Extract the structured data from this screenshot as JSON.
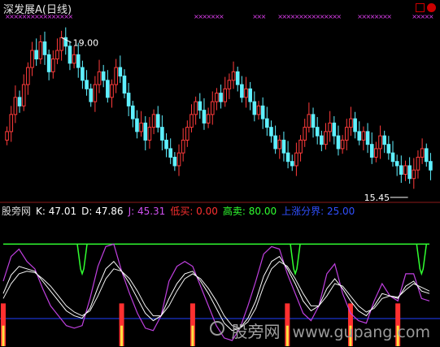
{
  "header": {
    "stock_title": "深发展A",
    "period": "(日线)"
  },
  "indicator_row": [
    {
      "label": "股旁网",
      "color": "#dcdcdc"
    },
    {
      "label": "K: 47.01",
      "color": "#ffffff"
    },
    {
      "label": "D: 47.86",
      "color": "#ffffff"
    },
    {
      "label": "J: 45.31",
      "color": "#d050f0"
    },
    {
      "label": "低买: 0.00",
      "color": "#ff3030"
    },
    {
      "label": "高卖: 80.00",
      "color": "#30ff30"
    },
    {
      "label": "上涨分界: 25.00",
      "color": "#3050ff"
    }
  ],
  "watermark": {
    "cn": "股旁网",
    "url": "www.gupang.com"
  },
  "colors": {
    "up_candle": "#ff3b3b",
    "down_candle": "#5ff0ff",
    "marker": "#e040f0",
    "k_line": "#ffffff",
    "d_line": "#f0f0f0",
    "j_line": "#c040e0",
    "sell_line": "#30ff30",
    "buy_bar": "#ff3030",
    "buy_bar_core": "#ffe040",
    "boundary": "#2040ff"
  },
  "chart_data": [
    {
      "type": "candlestick",
      "title": "深发展A (日线)",
      "annotations": [
        {
          "text": "19.00",
          "x_index": 13,
          "price": 19.0
        },
        {
          "text": "15.45",
          "x_index": 96,
          "price": 15.45
        }
      ],
      "ylim": [
        15.2,
        19.5
      ],
      "close_values": [
        16.8,
        17.2,
        17.6,
        17.4,
        17.9,
        18.3,
        18.7,
        18.5,
        18.9,
        18.6,
        18.2,
        18.5,
        18.7,
        19.0,
        18.8,
        18.4,
        18.6,
        18.3,
        18.0,
        17.8,
        17.5,
        17.9,
        18.2,
        18.0,
        17.6,
        17.9,
        18.3,
        18.1,
        17.7,
        17.4,
        17.1,
        16.8,
        17.0,
        16.6,
        16.9,
        17.2,
        16.9,
        16.6,
        16.4,
        16.2,
        16.0,
        16.3,
        16.6,
        16.9,
        17.2,
        17.5,
        17.3,
        17.0,
        17.2,
        17.5,
        17.7,
        17.5,
        17.8,
        18.0,
        18.2,
        17.9,
        17.6,
        17.8,
        17.5,
        17.2,
        17.4,
        17.1,
        16.9,
        16.7,
        16.4,
        16.6,
        16.3,
        16.1,
        16.0,
        16.3,
        16.6,
        16.9,
        17.2,
        16.9,
        16.7,
        16.5,
        16.8,
        17.0,
        16.7,
        16.4,
        16.6,
        16.9,
        17.1,
        16.8,
        16.6,
        16.8,
        16.5,
        16.2,
        16.4,
        16.7,
        16.5,
        16.3,
        16.1,
        16.0,
        15.8,
        16.0,
        15.7,
        15.9,
        16.2,
        16.4,
        16.1,
        15.9
      ]
    },
    {
      "type": "line",
      "title": "股旁网",
      "ylim": [
        0,
        100
      ],
      "series": [
        {
          "name": "K",
          "values": [
            40,
            55,
            62,
            60,
            58,
            50,
            42,
            34,
            26,
            22,
            20,
            28,
            45,
            60,
            66,
            58,
            48,
            36,
            24,
            18,
            22,
            36,
            48,
            56,
            58,
            50,
            40,
            28,
            16,
            10,
            12,
            20,
            34,
            54,
            66,
            70,
            60,
            48,
            34,
            26,
            30,
            44,
            52,
            44,
            34,
            26,
            22,
            30,
            40,
            38,
            36,
            46,
            50,
            42,
            40
          ]
        },
        {
          "name": "D",
          "values": [
            36,
            48,
            56,
            58,
            57,
            52,
            46,
            38,
            30,
            25,
            22,
            26,
            38,
            52,
            60,
            58,
            52,
            42,
            30,
            22,
            22,
            30,
            42,
            52,
            56,
            52,
            44,
            34,
            22,
            14,
            12,
            17,
            28,
            46,
            60,
            66,
            62,
            52,
            40,
            30,
            30,
            38,
            48,
            46,
            38,
            30,
            25,
            28,
            36,
            38,
            37,
            43,
            48,
            45,
            42
          ]
        },
        {
          "name": "J",
          "values": [
            50,
            70,
            76,
            66,
            60,
            44,
            30,
            22,
            14,
            12,
            14,
            36,
            62,
            78,
            80,
            58,
            40,
            24,
            12,
            10,
            22,
            50,
            62,
            66,
            62,
            46,
            30,
            14,
            4,
            2,
            12,
            30,
            50,
            72,
            78,
            76,
            56,
            40,
            24,
            18,
            30,
            56,
            64,
            40,
            24,
            18,
            16,
            34,
            48,
            38,
            34,
            56,
            56,
            36,
            34
          ]
        },
        {
          "name": "高卖",
          "values": [
            80,
            80,
            80,
            80,
            80,
            80,
            80,
            80,
            80,
            80,
            80,
            80,
            80,
            80,
            80,
            80,
            80,
            80,
            80,
            80,
            80,
            80,
            80,
            80,
            80,
            80,
            80,
            80,
            80,
            80,
            80,
            80,
            80,
            80,
            80,
            80,
            80,
            80,
            80,
            80,
            80,
            80,
            80,
            80,
            80,
            80,
            80,
            80,
            80,
            80,
            80,
            80,
            80,
            80,
            80
          ]
        },
        {
          "name": "上涨分界",
          "values": [
            25,
            25,
            25,
            25,
            25,
            25,
            25,
            25,
            25,
            25,
            25,
            25,
            25,
            25,
            25,
            25,
            25,
            25,
            25,
            25,
            25,
            25,
            25,
            25,
            25,
            25,
            25,
            25,
            25,
            25,
            25,
            25,
            25,
            25,
            25,
            25,
            25,
            25,
            25,
            25,
            25,
            25,
            25,
            25,
            25,
            25,
            25,
            25,
            25,
            25,
            25,
            25,
            25,
            25,
            25
          ]
        }
      ]
    }
  ]
}
